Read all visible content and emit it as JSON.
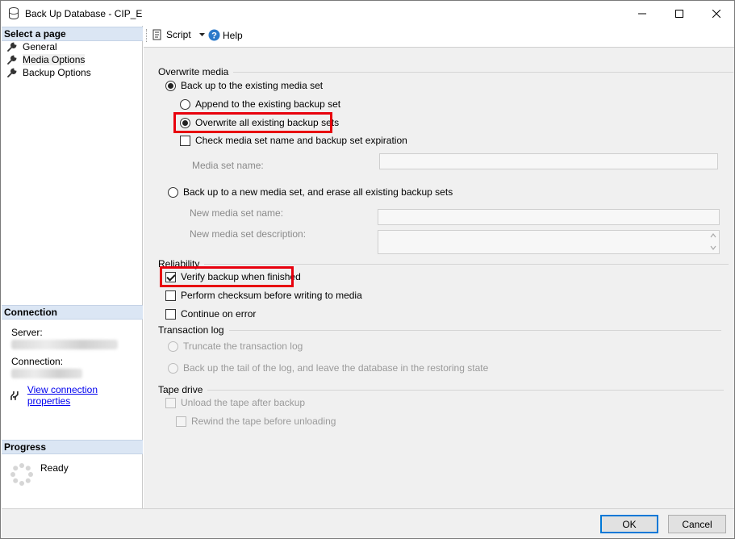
{
  "window": {
    "title": "Back Up Database - CIP_E",
    "icon": "database-icon"
  },
  "left": {
    "select_page_header": "Select a page",
    "pages": [
      {
        "label": "General"
      },
      {
        "label": "Media Options"
      },
      {
        "label": "Backup Options"
      }
    ],
    "connection_header": "Connection",
    "server_label": "Server:",
    "connection_label": "Connection:",
    "view_connection_link": "View connection properties",
    "progress_header": "Progress",
    "progress_status": "Ready"
  },
  "toolbar": {
    "script_label": "Script",
    "help_label": "Help"
  },
  "overwrite_media": {
    "title": "Overwrite media",
    "existing_set": "Back up to the existing media set",
    "append": "Append to the existing backup set",
    "overwrite_all": "Overwrite all existing backup sets",
    "check_name_expiration": "Check media set name and backup set expiration",
    "media_set_name_label": "Media set name:",
    "new_media_set": "Back up to a new media set, and erase all existing backup sets",
    "new_media_set_name_label": "New media set name:",
    "new_media_set_desc_label": "New media set description:"
  },
  "reliability": {
    "title": "Reliability",
    "verify": "Verify backup when finished",
    "checksum": "Perform checksum before writing to media",
    "continue_on_error": "Continue on error"
  },
  "transaction_log": {
    "title": "Transaction log",
    "truncate": "Truncate the transaction log",
    "tail": "Back up the tail of the log, and leave the database in the restoring state"
  },
  "tape_drive": {
    "title": "Tape drive",
    "unload": "Unload the tape after backup",
    "rewind": "Rewind the tape before unloading"
  },
  "buttons": {
    "ok": "OK",
    "cancel": "Cancel"
  },
  "colors": {
    "highlight": "#e8000d",
    "header_band": "#dbe6f4",
    "link": "#0000ee",
    "default_button_border": "#0078d7"
  }
}
